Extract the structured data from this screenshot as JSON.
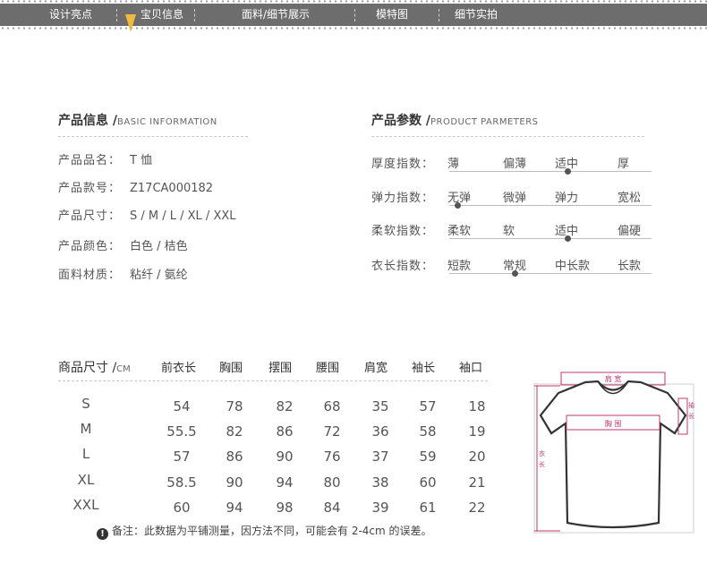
{
  "nav": {
    "items": [
      "设计亮点",
      "宝贝信息",
      "面料/细节展示",
      "模特图",
      "细节实拍"
    ],
    "active_index": 1
  },
  "product_info": {
    "title": "产品信息 /",
    "subtitle": "BASIC INFORMATION",
    "rows": [
      {
        "label": "产品品名：",
        "value": "T 恤"
      },
      {
        "label": "产品款号：",
        "value": "Z17CA000182"
      },
      {
        "label": "产品尺寸：",
        "value": "S / M / L / XL / XXL"
      },
      {
        "label": "产品颜色：",
        "value": "白色 / 桔色"
      },
      {
        "label": "面料材质：",
        "value": "粘纤 / 氨纶"
      }
    ]
  },
  "product_params": {
    "title": "产品参数 /",
    "subtitle": "PRODUCT PARMETERS",
    "rows": [
      {
        "label": "厚度指数：",
        "options": [
          "薄",
          "偏薄",
          "适中",
          "厚"
        ],
        "selected": 2
      },
      {
        "label": "弹力指数：",
        "options": [
          "无弹",
          "微弹",
          "弹力",
          "宽松"
        ],
        "selected": 0
      },
      {
        "label": "柔软指数：",
        "options": [
          "柔软",
          "软",
          "适中",
          "偏硬"
        ],
        "selected": 2
      },
      {
        "label": "衣长指数：",
        "options": [
          "短款",
          "常规",
          "中长款",
          "长款"
        ],
        "selected": 1
      }
    ]
  },
  "size_table": {
    "header_label": "商品尺寸 /",
    "unit": "CM",
    "columns": [
      "前衣长",
      "胸围",
      "摆围",
      "腰围",
      "肩宽",
      "袖长",
      "袖口"
    ],
    "rows": [
      {
        "size": "S",
        "values": [
          "54",
          "78",
          "82",
          "68",
          "35",
          "57",
          "18"
        ]
      },
      {
        "size": "M",
        "values": [
          "55.5",
          "82",
          "86",
          "72",
          "36",
          "58",
          "19"
        ]
      },
      {
        "size": "L",
        "values": [
          "57",
          "86",
          "90",
          "76",
          "37",
          "59",
          "20"
        ]
      },
      {
        "size": "XL",
        "values": [
          "58.5",
          "90",
          "94",
          "80",
          "38",
          "60",
          "21"
        ]
      },
      {
        "size": "XXL",
        "values": [
          "60",
          "94",
          "98",
          "84",
          "39",
          "61",
          "22"
        ]
      }
    ]
  },
  "note": {
    "icon": "!",
    "text": "备注：此数据为平铺测量，因方法不同，可能会有 2-4cm 的误差。"
  },
  "diagram": {
    "shoulder_label": "肩 宽",
    "chest_label": "胸 围",
    "length_label": "衣长",
    "sleeve_label": "袖长",
    "measure_color": "#c0396b"
  },
  "colors": {
    "nav_bg": "#6d6d6d",
    "nav_pointer": "#f0b940",
    "text": "#555555"
  }
}
